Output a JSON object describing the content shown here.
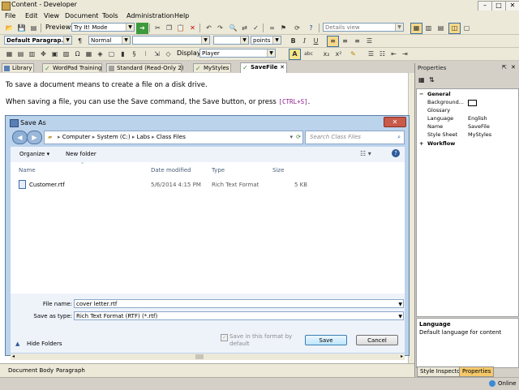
{
  "window": {
    "title": "Content - Developer",
    "controls": [
      "–",
      "□",
      "✕"
    ]
  },
  "menu": [
    "File",
    "Edit",
    "View",
    "Document",
    "Tools",
    "Administration",
    "Help"
  ],
  "toolbar1": {
    "preview_label": "Preview:",
    "preview_value": "Try It! Mode",
    "view_value": "Details view"
  },
  "toolbar2": {
    "paragraph_value": "Default Paragrap...",
    "style_value": "Normal",
    "font_value": "",
    "size_value": "",
    "units_value": "points"
  },
  "toolbar3": {
    "display_label": "Display:",
    "display_value": "Player"
  },
  "tabs": [
    {
      "label": "Library"
    },
    {
      "label": "WordPad Training"
    },
    {
      "label": "Standard (Read-Only 2)"
    },
    {
      "label": "MyStyles"
    },
    {
      "label": "SaveFile"
    }
  ],
  "editor": {
    "line1": "To save a document means to create a file on a disk drive.",
    "line2_prefix": "When saving a file, you can use the Save command, the Save button, or press ",
    "line2_key": "[CTRL+S]",
    "line2_suffix": "."
  },
  "dialog": {
    "title": "Save As",
    "breadcrumb": [
      "Computer",
      "System (C:)",
      "Labs",
      "Class Files"
    ],
    "search_placeholder": "Search Class Files",
    "organize_label": "Organize",
    "new_folder_label": "New folder",
    "columns": [
      "Name",
      "Date modified",
      "Type",
      "Size"
    ],
    "files": [
      {
        "name": "Customer.rtf",
        "date": "5/6/2014 4:15 PM",
        "type": "Rich Text Format",
        "size": "5 KB"
      }
    ],
    "file_name_label": "File name:",
    "file_name_value": "cover letter.rtf",
    "save_type_label": "Save as type:",
    "save_type_value": "Rich Text Format (RTF) (*.rtf)",
    "default_format_label": "Save in this format by default",
    "hide_folders_label": "Hide Folders",
    "save_label": "Save",
    "cancel_label": "Cancel"
  },
  "statusbar": {
    "document_body": "Document Body",
    "paragraph": "Paragraph"
  },
  "app_status": {
    "online": "Online"
  },
  "properties": {
    "title": "Properties",
    "categories": [
      {
        "name": "General",
        "rows": [
          {
            "key": "Background...",
            "value": ""
          },
          {
            "key": "Glossary",
            "value": ""
          },
          {
            "key": "Language",
            "value": "English"
          },
          {
            "key": "Name",
            "value": "SaveFile"
          },
          {
            "key": "Style Sheet",
            "value": "MyStyles"
          }
        ]
      },
      {
        "name": "Workflow",
        "rows": []
      }
    ],
    "desc_title": "Language",
    "desc_text": "Default language for content",
    "tabs": [
      "Style Inspector",
      "Properties"
    ]
  },
  "colors": {
    "accent": "#3a6ea5",
    "dialog_frame": "#bcd3ec",
    "selected_tab": "#f5c96b"
  }
}
